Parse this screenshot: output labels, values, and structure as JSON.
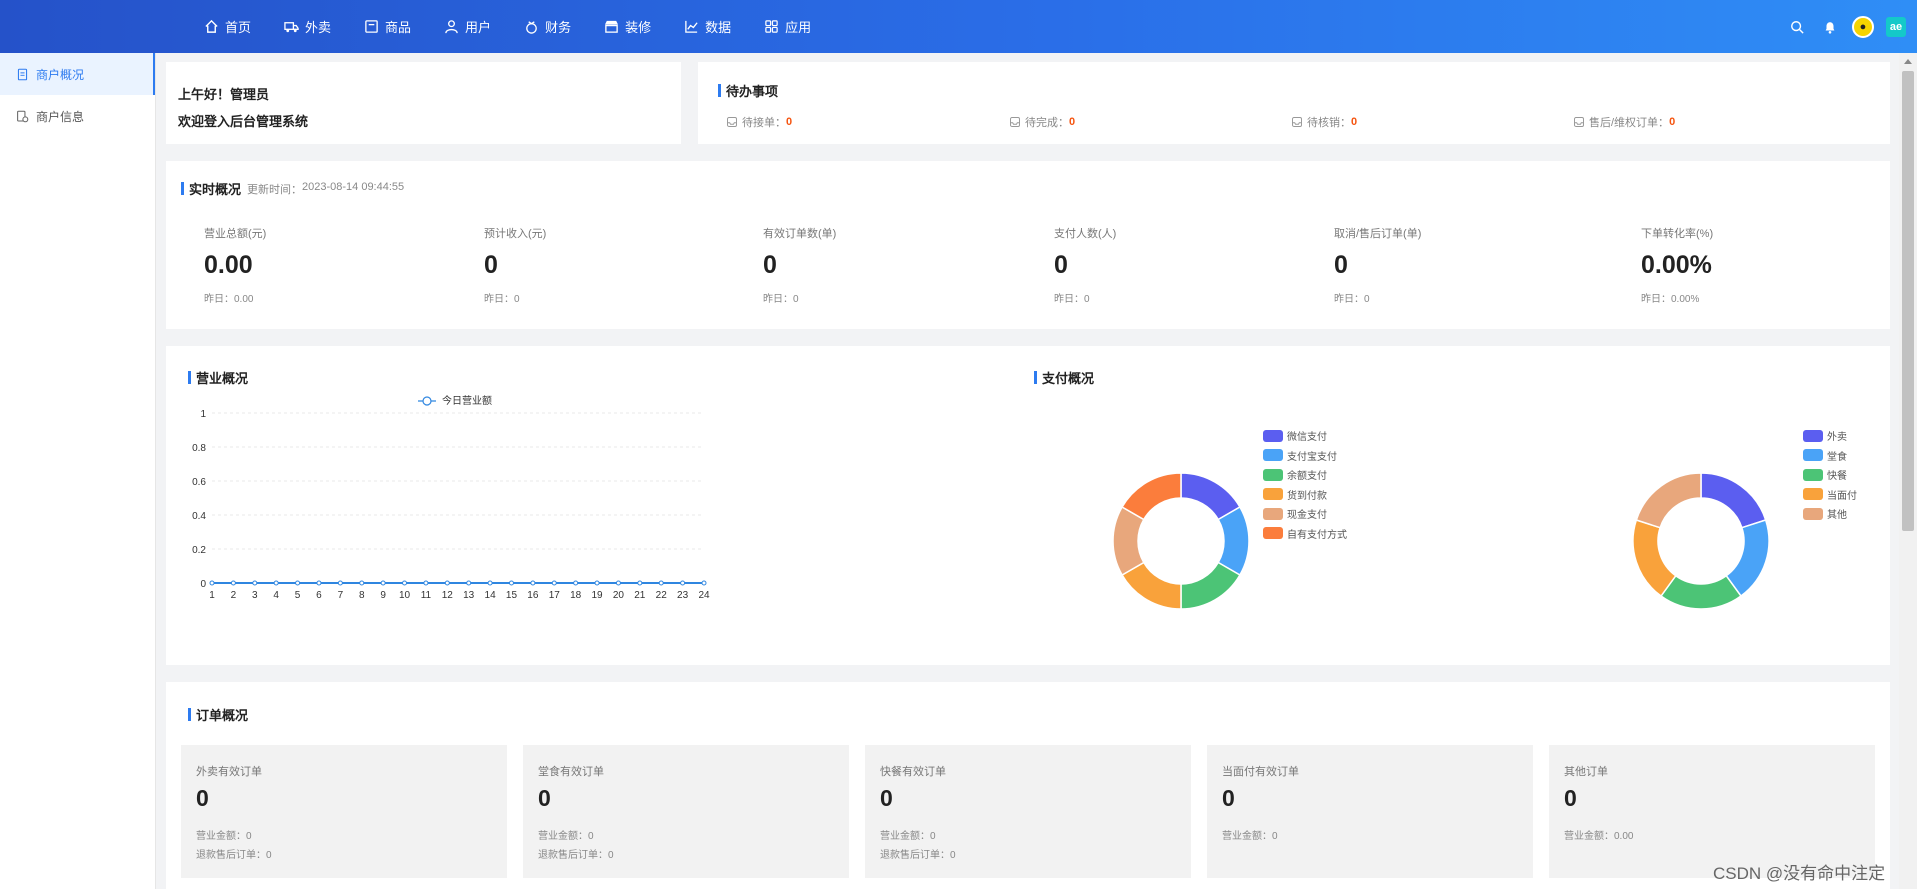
{
  "nav": {
    "items": [
      {
        "label": "首页",
        "icon": "home-icon"
      },
      {
        "label": "外卖",
        "icon": "delivery-icon"
      },
      {
        "label": "商品",
        "icon": "goods-icon"
      },
      {
        "label": "用户",
        "icon": "user-icon"
      },
      {
        "label": "财务",
        "icon": "finance-icon"
      },
      {
        "label": "装修",
        "icon": "store-icon"
      },
      {
        "label": "数据",
        "icon": "chart-icon"
      },
      {
        "label": "应用",
        "icon": "apps-icon"
      }
    ],
    "logo_text": "ae"
  },
  "sidebar": {
    "items": [
      {
        "label": "商户概况",
        "active": true
      },
      {
        "label": "商户信息",
        "active": false
      }
    ]
  },
  "welcome": {
    "line1": "上午好！管理员",
    "line2": "欢迎登入后台管理系统"
  },
  "todo": {
    "title": "待办事项",
    "items": [
      {
        "label": "待接单：",
        "value": "0"
      },
      {
        "label": "待完成：",
        "value": "0"
      },
      {
        "label": "待核销：",
        "value": "0"
      },
      {
        "label": "售后/维权订单：",
        "value": "0"
      }
    ]
  },
  "realtime": {
    "title": "实时概况",
    "update_label": "更新时间：",
    "update_time": "2023-08-14 09:44:55",
    "stats": [
      {
        "label": "营业总额(元)",
        "value": "0.00",
        "prev": "昨日：0.00"
      },
      {
        "label": "预计收入(元)",
        "value": "0",
        "prev": "昨日：0"
      },
      {
        "label": "有效订单数(单)",
        "value": "0",
        "prev": "昨日：0"
      },
      {
        "label": "支付人数(人)",
        "value": "0",
        "prev": "昨日：0"
      },
      {
        "label": "取消/售后订单(单)",
        "value": "0",
        "prev": "昨日：0"
      },
      {
        "label": "下单转化率(%)",
        "value": "0.00%",
        "prev": "昨日：0.00%"
      }
    ]
  },
  "business": {
    "title": "营业概况",
    "pay_title": "支付概况"
  },
  "chart_data": [
    {
      "type": "line",
      "title": "营业概况",
      "series": [
        {
          "name": "今日营业额",
          "values": [
            0,
            0,
            0,
            0,
            0,
            0,
            0,
            0,
            0,
            0,
            0,
            0,
            0,
            0,
            0,
            0,
            0,
            0,
            0,
            0,
            0,
            0,
            0,
            0
          ]
        }
      ],
      "x": [
        "1",
        "2",
        "3",
        "4",
        "5",
        "6",
        "7",
        "8",
        "9",
        "10",
        "11",
        "12",
        "13",
        "14",
        "15",
        "16",
        "17",
        "18",
        "19",
        "20",
        "21",
        "22",
        "23",
        "24"
      ],
      "yticks": [
        "0",
        "0.2",
        "0.4",
        "0.6",
        "0.8",
        "1"
      ],
      "ylim": [
        0,
        1
      ],
      "grid": true,
      "color": "#2f86e0"
    },
    {
      "type": "pie",
      "categories": [
        "微信支付",
        "支付宝支付",
        "余额支付",
        "货到付款",
        "现金支付",
        "自有支付方式"
      ],
      "values": [
        1,
        1,
        1,
        1,
        1,
        1
      ],
      "colors": [
        "#5b5ef0",
        "#4aa3f7",
        "#4cc476",
        "#f9a23b",
        "#e8a77c",
        "#fb7d3c"
      ]
    },
    {
      "type": "pie",
      "categories": [
        "外卖",
        "堂食",
        "快餐",
        "当面付",
        "其他"
      ],
      "values": [
        1,
        1,
        1,
        1,
        1
      ],
      "colors": [
        "#5b5ef0",
        "#4aa3f7",
        "#4cc476",
        "#f9a23b",
        "#e8a77c"
      ]
    }
  ],
  "orders": {
    "title": "订单概况",
    "cards": [
      {
        "label": "外卖有效订单",
        "value": "0",
        "a": "营业金额：0",
        "b": "退款售后订单：0"
      },
      {
        "label": "堂食有效订单",
        "value": "0",
        "a": "营业金额：0",
        "b": "退款售后订单：0"
      },
      {
        "label": "快餐有效订单",
        "value": "0",
        "a": "营业金额：0",
        "b": "退款售后订单：0"
      },
      {
        "label": "当面付有效订单",
        "value": "0",
        "a": "营业金额：0",
        "b": ""
      },
      {
        "label": "其他订单",
        "value": "0",
        "a": "营业金额：0.00",
        "b": ""
      }
    ]
  },
  "watermark": "CSDN @没有命中注定",
  "colors": {
    "accent": "#2d7bf0",
    "alert": "#f5540f"
  }
}
